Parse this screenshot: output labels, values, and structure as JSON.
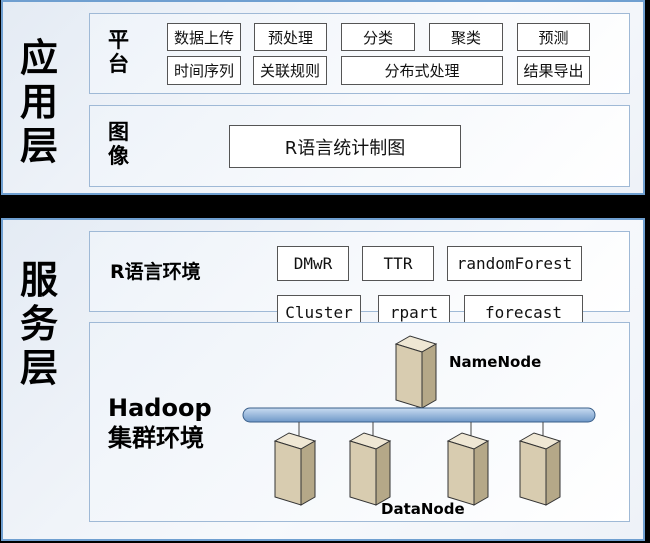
{
  "app_layer": {
    "title": "应用层",
    "platform": {
      "label": "平台",
      "items": [
        "数据上传",
        "预处理",
        "分类",
        "聚类",
        "预测",
        "时间序列",
        "关联规则",
        "分布式处理",
        "结果导出"
      ]
    },
    "image": {
      "label": "图像",
      "items": [
        "R语言统计制图"
      ]
    }
  },
  "service_layer": {
    "title": "服务层",
    "r_env": {
      "label": "R语言环境",
      "packages": [
        "DMwR",
        "TTR",
        "randomForest",
        "Cluster",
        "rpart",
        "forecast"
      ]
    },
    "hadoop": {
      "label_line1": "Hadoop",
      "label_line2": "集群环境",
      "namenode": "NameNode",
      "datanode": "DataNode"
    }
  },
  "colors": {
    "panel_border": "#6f9fd0",
    "bus": "#8fb3dc",
    "server": "#d8ccb0"
  }
}
